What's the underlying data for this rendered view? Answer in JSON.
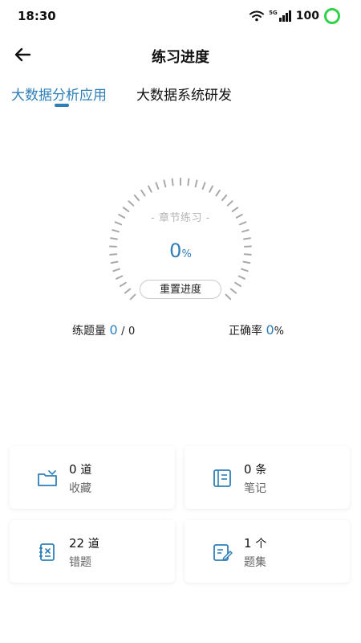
{
  "status_bar": {
    "time": "18:30",
    "signal_label": "5G",
    "battery": "100",
    "icons": [
      "wifi-icon",
      "signal-icon",
      "battery-icon"
    ]
  },
  "header": {
    "title": "练习进度",
    "back_icon": "arrow-left-icon"
  },
  "tabs": [
    {
      "label": "大数据分析应用",
      "active": true
    },
    {
      "label": "大数据系统研发",
      "active": false
    }
  ],
  "gauge": {
    "label": "- 章节练习 -",
    "progress_value": "0",
    "progress_unit": "%"
  },
  "reset_button": "重置进度",
  "stats": {
    "practice_label": "练题量",
    "practice_done": "0",
    "practice_sep": "/",
    "practice_total": "0",
    "accuracy_label": "正确率",
    "accuracy_value": "0",
    "accuracy_unit": "%"
  },
  "cards": [
    {
      "count": "0",
      "unit": "道",
      "label": "收藏",
      "icon": "folder-icon"
    },
    {
      "count": "0",
      "unit": "条",
      "label": "笔记",
      "icon": "notebook-icon"
    },
    {
      "count": "22",
      "unit": "道",
      "label": "错题",
      "icon": "error-list-icon"
    },
    {
      "count": "1",
      "unit": "个",
      "label": "题集",
      "icon": "edit-doc-icon"
    }
  ],
  "colors": {
    "accent": "#2e7fb8",
    "battery": "#2fd34a",
    "tick": "#a9a9a9"
  }
}
